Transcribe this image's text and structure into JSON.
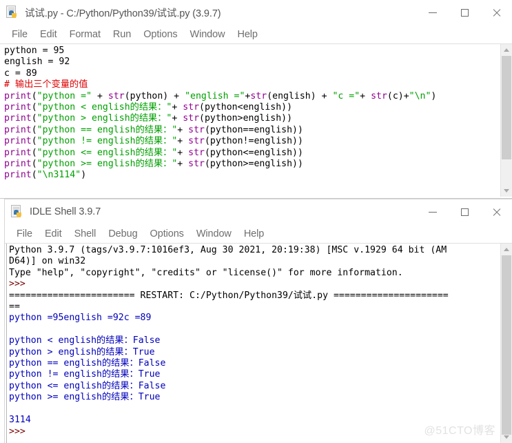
{
  "editor_window": {
    "title": "试试.py - C:/Python/Python39/试试.py (3.9.7)",
    "icon": "python-file-icon",
    "window_buttons": {
      "minimize": "minimize-icon",
      "maximize": "maximize-icon",
      "close": "close-icon"
    },
    "menu": [
      "File",
      "Edit",
      "Format",
      "Run",
      "Options",
      "Window",
      "Help"
    ],
    "code_lines": [
      [
        {
          "t": "python = 95",
          "c": "plain"
        }
      ],
      [
        {
          "t": "english = 92",
          "c": "plain"
        }
      ],
      [
        {
          "t": "c = 89",
          "c": "plain"
        }
      ],
      [
        {
          "t": "# 输出三个变量的值",
          "c": "comment"
        }
      ],
      [
        {
          "t": "print",
          "c": "builtin"
        },
        {
          "t": "(",
          "c": "plain"
        },
        {
          "t": "\"python =\"",
          "c": "string"
        },
        {
          "t": " + ",
          "c": "plain"
        },
        {
          "t": "str",
          "c": "builtin"
        },
        {
          "t": "(python) + ",
          "c": "plain"
        },
        {
          "t": "\"english =\"",
          "c": "string"
        },
        {
          "t": "+",
          "c": "plain"
        },
        {
          "t": "str",
          "c": "builtin"
        },
        {
          "t": "(english) + ",
          "c": "plain"
        },
        {
          "t": "\"c =\"",
          "c": "string"
        },
        {
          "t": "+ ",
          "c": "plain"
        },
        {
          "t": "str",
          "c": "builtin"
        },
        {
          "t": "(c)+",
          "c": "plain"
        },
        {
          "t": "\"\\n\"",
          "c": "string"
        },
        {
          "t": ")",
          "c": "plain"
        }
      ],
      [
        {
          "t": "print",
          "c": "builtin"
        },
        {
          "t": "(",
          "c": "plain"
        },
        {
          "t": "\"python < english的结果：\"",
          "c": "string"
        },
        {
          "t": "+ ",
          "c": "plain"
        },
        {
          "t": "str",
          "c": "builtin"
        },
        {
          "t": "(python<english))",
          "c": "plain"
        }
      ],
      [
        {
          "t": "print",
          "c": "builtin"
        },
        {
          "t": "(",
          "c": "plain"
        },
        {
          "t": "\"python > english的结果：\"",
          "c": "string"
        },
        {
          "t": "+ ",
          "c": "plain"
        },
        {
          "t": "str",
          "c": "builtin"
        },
        {
          "t": "(python>english))",
          "c": "plain"
        }
      ],
      [
        {
          "t": "print",
          "c": "builtin"
        },
        {
          "t": "(",
          "c": "plain"
        },
        {
          "t": "\"python == english的结果：\"",
          "c": "string"
        },
        {
          "t": "+ ",
          "c": "plain"
        },
        {
          "t": "str",
          "c": "builtin"
        },
        {
          "t": "(python==english))",
          "c": "plain"
        }
      ],
      [
        {
          "t": "print",
          "c": "builtin"
        },
        {
          "t": "(",
          "c": "plain"
        },
        {
          "t": "\"python != english的结果：\"",
          "c": "string"
        },
        {
          "t": "+ ",
          "c": "plain"
        },
        {
          "t": "str",
          "c": "builtin"
        },
        {
          "t": "(python!=english))",
          "c": "plain"
        }
      ],
      [
        {
          "t": "print",
          "c": "builtin"
        },
        {
          "t": "(",
          "c": "plain"
        },
        {
          "t": "\"python <= english的结果：\"",
          "c": "string"
        },
        {
          "t": "+ ",
          "c": "plain"
        },
        {
          "t": "str",
          "c": "builtin"
        },
        {
          "t": "(python<=english))",
          "c": "plain"
        }
      ],
      [
        {
          "t": "print",
          "c": "builtin"
        },
        {
          "t": "(",
          "c": "plain"
        },
        {
          "t": "\"python >= english的结果：\"",
          "c": "string"
        },
        {
          "t": "+ ",
          "c": "plain"
        },
        {
          "t": "str",
          "c": "builtin"
        },
        {
          "t": "(python>=english))",
          "c": "plain"
        }
      ],
      [
        {
          "t": "print",
          "c": "builtin"
        },
        {
          "t": "(",
          "c": "plain"
        },
        {
          "t": "\"\\n3114\"",
          "c": "string"
        },
        {
          "t": ")",
          "c": "plain"
        }
      ]
    ]
  },
  "shell_window": {
    "title": "IDLE Shell 3.9.7",
    "icon": "python-file-icon",
    "window_buttons": {
      "minimize": "minimize-icon",
      "maximize": "maximize-icon",
      "close": "close-icon"
    },
    "menu": [
      "File",
      "Edit",
      "Shell",
      "Debug",
      "Options",
      "Window",
      "Help"
    ],
    "output_lines": [
      [
        {
          "t": "Python 3.9.7 (tags/v3.9.7:1016ef3, Aug 30 2021, 20:19:38) [MSC v.1929 64 bit (AM",
          "c": "plain"
        }
      ],
      [
        {
          "t": "D64)] on win32",
          "c": "plain"
        }
      ],
      [
        {
          "t": "Type \"help\", \"copyright\", \"credits\" or \"license()\" for more information.",
          "c": "plain"
        }
      ],
      [
        {
          "t": ">>>",
          "c": "prompt"
        }
      ],
      [
        {
          "t": "======================= RESTART: C:/Python/Python39/试试.py =====================",
          "c": "plain"
        }
      ],
      [
        {
          "t": "==",
          "c": "plain"
        }
      ],
      [
        {
          "t": "python =95english =92c =89",
          "c": "stdout"
        }
      ],
      [
        {
          "t": "",
          "c": "stdout"
        }
      ],
      [
        {
          "t": "python < english的结果：False",
          "c": "stdout"
        }
      ],
      [
        {
          "t": "python > english的结果：True",
          "c": "stdout"
        }
      ],
      [
        {
          "t": "python == english的结果：False",
          "c": "stdout"
        }
      ],
      [
        {
          "t": "python != english的结果：True",
          "c": "stdout"
        }
      ],
      [
        {
          "t": "python <= english的结果：False",
          "c": "stdout"
        }
      ],
      [
        {
          "t": "python >= english的结果：True",
          "c": "stdout"
        }
      ],
      [
        {
          "t": "",
          "c": "stdout"
        }
      ],
      [
        {
          "t": "3114",
          "c": "stdout"
        }
      ],
      [
        {
          "t": ">>>",
          "c": "prompt"
        }
      ]
    ]
  },
  "watermark": {
    "text": "@51CTO博客"
  },
  "colors": {
    "comment": "#DD0000",
    "string": "#00A000",
    "builtin": "#900090",
    "stdout": "#0000BB",
    "prompt": "#770000",
    "plain": "#000000"
  }
}
